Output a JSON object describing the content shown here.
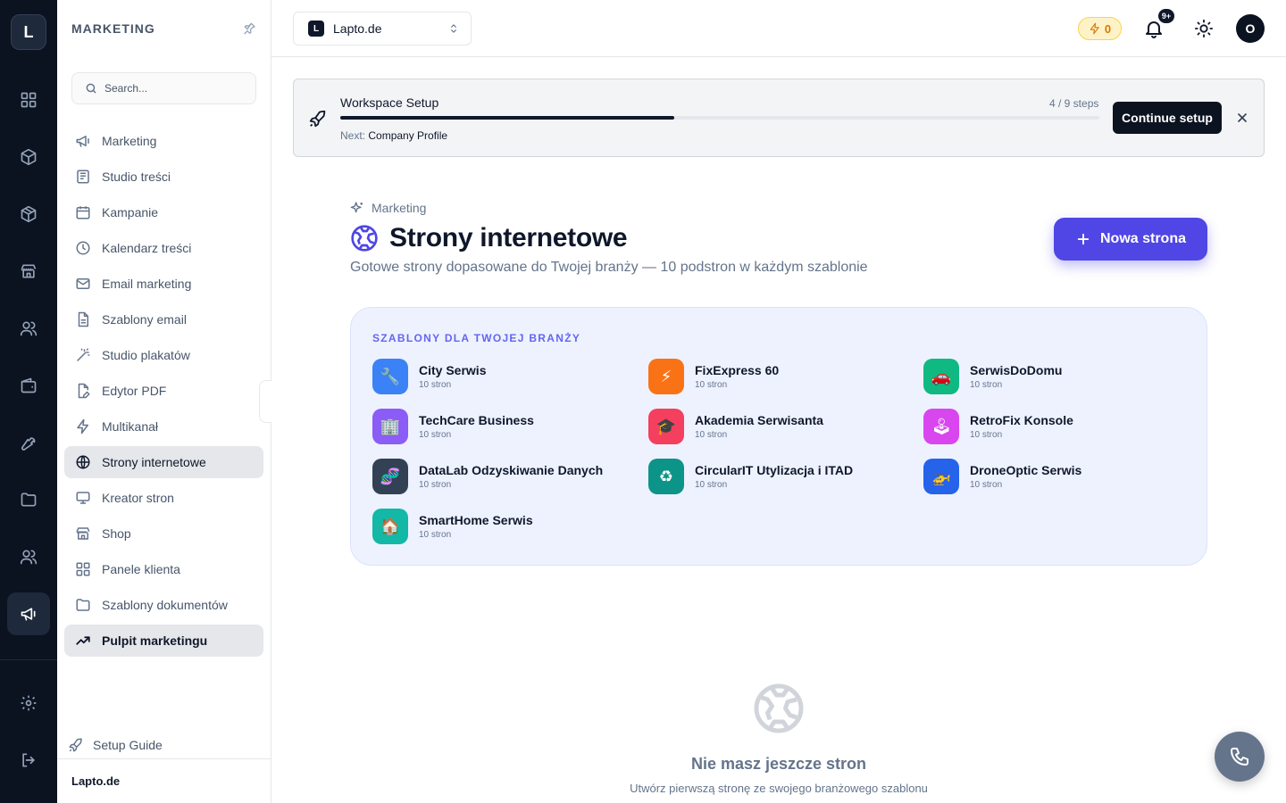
{
  "rail": {
    "logo": "L",
    "items": [
      "grid-icon",
      "package-icon",
      "box-icon",
      "store-icon",
      "users-icon",
      "wallet-icon",
      "wrench-icon",
      "folder-icon",
      "team-icon",
      "megaphone-icon",
      "briefcase-icon"
    ],
    "active": "megaphone-icon",
    "bottom": [
      "settings-icon",
      "logout-icon"
    ]
  },
  "sidebar": {
    "title": "MARKETING",
    "search_placeholder": "Search...",
    "items": [
      {
        "label": "Marketing",
        "icon": "megaphone-icon"
      },
      {
        "label": "Studio treści",
        "icon": "newspaper-icon"
      },
      {
        "label": "Kampanie",
        "icon": "calendar-icon"
      },
      {
        "label": "Kalendarz treści",
        "icon": "clock-icon"
      },
      {
        "label": "Email marketing",
        "icon": "mail-icon"
      },
      {
        "label": "Szablony email",
        "icon": "file-text-icon"
      },
      {
        "label": "Studio plakatów",
        "icon": "wand-icon"
      },
      {
        "label": "Edytor PDF",
        "icon": "file-edit-icon"
      },
      {
        "label": "Multikanał",
        "icon": "zap-icon"
      },
      {
        "label": "Strony internetowe",
        "icon": "globe-icon"
      },
      {
        "label": "Kreator stron",
        "icon": "monitor-icon"
      },
      {
        "label": "Shop",
        "icon": "store-icon"
      },
      {
        "label": "Panele klienta",
        "icon": "grid-icon"
      },
      {
        "label": "Szablony dokumentów",
        "icon": "folder-icon"
      },
      {
        "label": "Pulpit marketingu",
        "icon": "trending-up-icon"
      }
    ],
    "setup_guide": "Setup Guide",
    "footer": "Lapto.de"
  },
  "topbar": {
    "workspace_badge": "L",
    "workspace_name": "Lapto.de",
    "credits": "0",
    "notifications_badge": "9+",
    "avatar": "O"
  },
  "setup": {
    "title": "Workspace Setup",
    "steps": "4 / 9 steps",
    "progress": 0.44,
    "next_label": "Next:",
    "next_value": "Company Profile",
    "button": "Continue setup"
  },
  "page": {
    "breadcrumb": "Marketing",
    "title": "Strony internetowe",
    "subtitle": "Gotowe strony dopasowane do Twojej branży — 10 podstron w każdym szablonie",
    "new_button": "Nowa strona"
  },
  "templates": {
    "heading": "SZABLONY DLA TWOJEJ BRANŻY",
    "items": [
      {
        "name": "City Serwis",
        "count": "10 stron",
        "glyph": "🔧",
        "color": "#3b82f6"
      },
      {
        "name": "FixExpress 60",
        "count": "10 stron",
        "glyph": "⚡",
        "color": "#f97316"
      },
      {
        "name": "SerwisDoDomu",
        "count": "10 stron",
        "glyph": "🚗",
        "color": "#10b981"
      },
      {
        "name": "TechCare Business",
        "count": "10 stron",
        "glyph": "🏢",
        "color": "#8b5cf6"
      },
      {
        "name": "Akademia Serwisanta",
        "count": "10 stron",
        "glyph": "🎓",
        "color": "#f43f5e"
      },
      {
        "name": "RetroFix Konsole",
        "count": "10 stron",
        "glyph": "🕹",
        "color": "#d946ef"
      },
      {
        "name": "DataLab Odzyskiwanie Danych",
        "count": "10 stron",
        "glyph": "🧬",
        "color": "#334155"
      },
      {
        "name": "CircularIT Utylizacja i ITAD",
        "count": "10 stron",
        "glyph": "♻",
        "color": "#0d9488"
      },
      {
        "name": "DroneOptic Serwis",
        "count": "10 stron",
        "glyph": "🚁",
        "color": "#2563eb"
      },
      {
        "name": "SmartHome Serwis",
        "count": "10 stron",
        "glyph": "🏠",
        "color": "#14b8a6"
      }
    ]
  },
  "empty": {
    "title": "Nie masz jeszcze stron",
    "subtitle": "Utwórz pierwszą stronę ze swojego branżowego szablonu"
  }
}
